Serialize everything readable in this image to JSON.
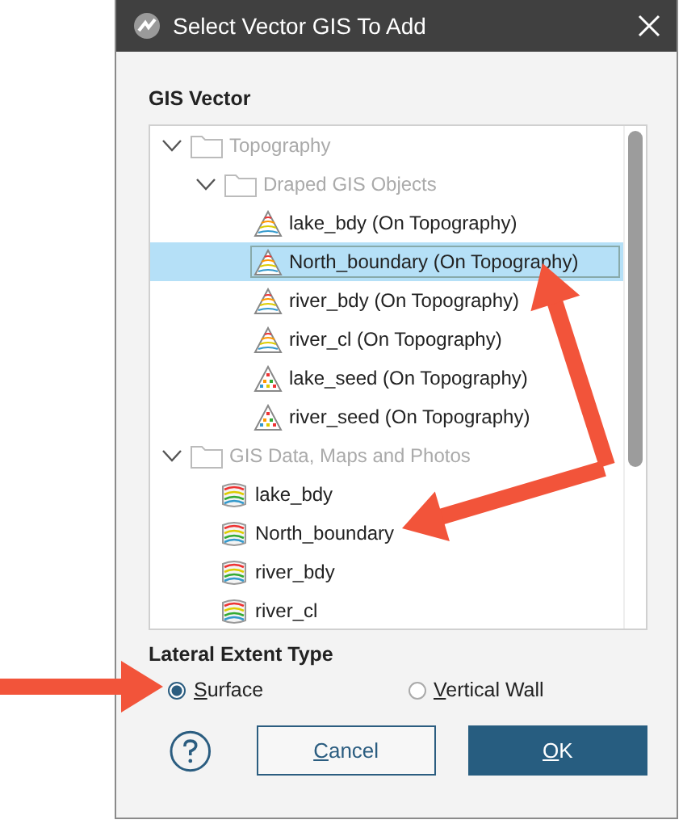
{
  "window": {
    "title": "Select Vector GIS To Add"
  },
  "gis_vector": {
    "label": "GIS Vector",
    "tree": [
      {
        "label": "Topography",
        "kind": "folder",
        "expanded": true,
        "selected": false,
        "children": [
          {
            "label": "Draped GIS Objects",
            "kind": "folder",
            "expanded": true,
            "selected": false,
            "children": [
              {
                "label": "lake_bdy (On Topography)",
                "kind": "draped-lines",
                "selected": false
              },
              {
                "label": "North_boundary (On Topography)",
                "kind": "draped-lines",
                "selected": true
              },
              {
                "label": "river_bdy (On Topography)",
                "kind": "draped-lines",
                "selected": false
              },
              {
                "label": "river_cl (On Topography)",
                "kind": "draped-lines",
                "selected": false
              },
              {
                "label": "lake_seed (On Topography)",
                "kind": "draped-points",
                "selected": false
              },
              {
                "label": "river_seed (On Topography)",
                "kind": "draped-points",
                "selected": false
              }
            ]
          }
        ]
      },
      {
        "label": "GIS Data, Maps and Photos",
        "kind": "folder",
        "expanded": true,
        "selected": false,
        "children": [
          {
            "label": "lake_bdy",
            "kind": "layers",
            "selected": false
          },
          {
            "label": "North_boundary",
            "kind": "layers",
            "selected": false
          },
          {
            "label": "river_bdy",
            "kind": "layers",
            "selected": false
          },
          {
            "label": "river_cl",
            "kind": "layers",
            "selected": false
          }
        ]
      }
    ]
  },
  "lateral_extent_type": {
    "label": "Lateral Extent Type",
    "options": [
      {
        "label": "Surface",
        "selected": true
      },
      {
        "label": "Vertical Wall",
        "selected": false
      }
    ]
  },
  "buttons": [
    {
      "label": "Cancel",
      "kind": "secondary"
    },
    {
      "label": "OK",
      "kind": "primary"
    }
  ]
}
